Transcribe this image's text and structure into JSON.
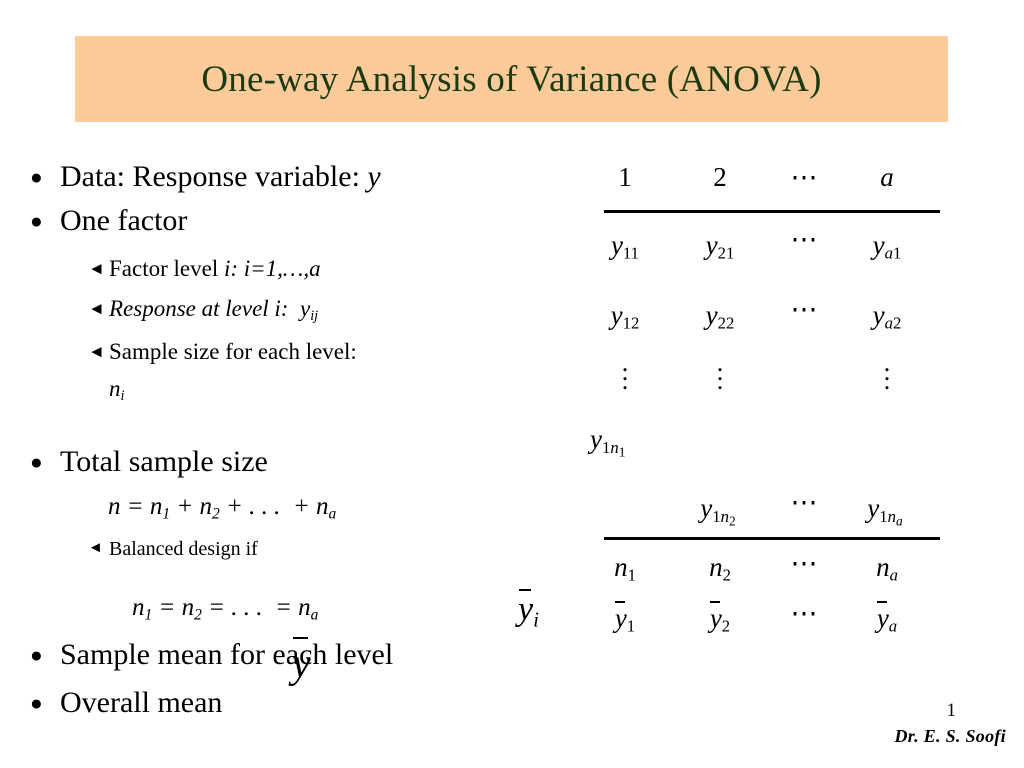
{
  "slide": {
    "title": "One-way Analysis of Variance (ANOVA)",
    "title_bg_color": "#fccb99",
    "title_text_color": "#1b3a0e",
    "background_color": "#ffffff"
  },
  "bullets": {
    "b1_label": "Data: Response variable:",
    "b1_symbol": "y",
    "b2_label": "One factor",
    "s1_text": "Factor level",
    "s1_math": "i: i=1,…,a",
    "s2_text": "Response at level i:",
    "s2_symbol_base": "y",
    "s2_symbol_sub": "ij",
    "s3_text": "Sample size for each level:",
    "s3_symbol_base": "n",
    "s3_symbol_sub": "i",
    "b3_label": "Total sample size",
    "f1_parts": [
      "n",
      " = ",
      "n",
      "1",
      " + ",
      "n",
      "2",
      " + . . .  + ",
      "n",
      "a"
    ],
    "f1_plain": "n = n1 + n2 + . . .  + na",
    "s4_text": "Balanced design if",
    "f2_plain": "n1 = n2 = . . .  = na",
    "b4_label": "Sample mean for each level",
    "b5_label": "Overall mean",
    "bullet_glyph_level1": "bullet-filled-circle",
    "bullet_glyph_level2": "left-pointing-triangle"
  },
  "overlays": {
    "group_mean_base": "y",
    "group_mean_sub": "i",
    "overall_mean_base": "y"
  },
  "table": {
    "header": [
      "1",
      "2",
      "⋯",
      "a"
    ],
    "rows": [
      {
        "cells": [
          "y11",
          "y21",
          "⋯",
          "ya1"
        ]
      },
      {
        "cells": [
          "y12",
          "y22",
          "⋯",
          "ya2"
        ]
      },
      {
        "cells": [
          "⋮",
          "⋮",
          "",
          "⋮"
        ]
      },
      {
        "cells": [
          "y1n1",
          "",
          "",
          ""
        ]
      },
      {
        "cells": [
          "",
          "y1n2",
          "⋯",
          "y1na"
        ]
      }
    ],
    "summary_rows": [
      {
        "cells": [
          "n1",
          "n2",
          "⋯",
          "na"
        ]
      },
      {
        "cells": [
          "ȳ1",
          "ȳ2",
          "⋯",
          "ȳa"
        ]
      }
    ],
    "ellipsis_horizontal": "⋯",
    "ellipsis_vertical": "⋮"
  },
  "footer": {
    "page_number": "1",
    "author": "Dr. E. S. Soofi"
  }
}
